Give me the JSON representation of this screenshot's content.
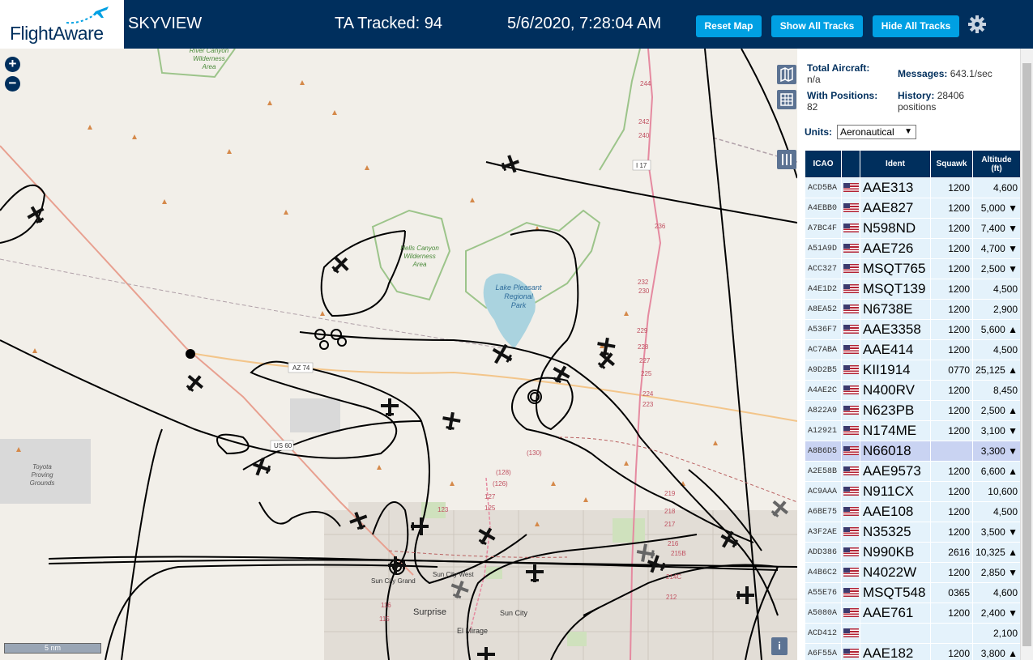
{
  "header": {
    "logo_text": "FlightAware",
    "app_title": "SKYVIEW",
    "tracked": "TA Tracked: 94",
    "datetime": "5/6/2020, 7:28:04 AM",
    "reset_map": "Reset Map",
    "show_all_tracks": "Show All Tracks",
    "hide_all_tracks": "Hide All Tracks"
  },
  "map": {
    "zoom_in": "+",
    "zoom_out": "−",
    "scale": "5 nm",
    "info": "i",
    "labels": {
      "river_canyon": [
        "River Canyon",
        "Wilderness",
        "Area"
      ],
      "hells_canyon": [
        "Hells Canyon",
        "Wilderness",
        "Area"
      ],
      "lake_pleasant": [
        "Lake Pleasant",
        "Regional",
        "Park"
      ],
      "toyota": [
        "Toyota",
        "Proving",
        "Grounds"
      ],
      "az74": "AZ 74",
      "us60": "US 60",
      "i17": "I 17",
      "surprise": "Surprise",
      "sun_city": "Sun City",
      "sun_city_west": "Sun City West",
      "sun_city_grand": "Sun City Grand",
      "el_mirage": "El Mirage"
    }
  },
  "stats": {
    "total_label": "Total Aircraft:",
    "total_value": "n/a",
    "positions_label": "With Positions:",
    "positions_value": "82",
    "messages_label": "Messages:",
    "messages_value": "643.1/sec",
    "history_label": "History:",
    "history_value_1": "28406",
    "history_value_2": "positions",
    "units_label": "Units:",
    "units_value": "Aeronautical"
  },
  "table": {
    "headers": {
      "icao": "ICAO",
      "ident": "Ident",
      "squawk": "Squawk",
      "alt_1": "Altitude",
      "alt_2": "(ft)"
    },
    "rows": [
      {
        "icao": "ACD5BA",
        "ident": "AAE313",
        "squawk": "1200",
        "alt": "4,600 "
      },
      {
        "icao": "A4EBB0",
        "ident": "AAE827",
        "squawk": "1200",
        "alt": "5,000 ▼"
      },
      {
        "icao": "A7BC4F",
        "ident": "N598ND",
        "squawk": "1200",
        "alt": "7,400 ▼"
      },
      {
        "icao": "A51A9D",
        "ident": "AAE726",
        "squawk": "1200",
        "alt": "4,700 ▼"
      },
      {
        "icao": "ACC327",
        "ident": "MSQT765",
        "squawk": "1200",
        "alt": "2,500 ▼"
      },
      {
        "icao": "A4E1D2",
        "ident": "MSQT139",
        "squawk": "1200",
        "alt": "4,500 "
      },
      {
        "icao": "A8EA52",
        "ident": "N6738E",
        "squawk": "1200",
        "alt": "2,900 "
      },
      {
        "icao": "A536F7",
        "ident": "AAE3358",
        "squawk": "1200",
        "alt": "5,600 ▲"
      },
      {
        "icao": "AC7ABA",
        "ident": "AAE414",
        "squawk": "1200",
        "alt": "4,500 "
      },
      {
        "icao": "A9D2B5",
        "ident": "KII1914",
        "squawk": "0770",
        "alt": "25,125 ▲"
      },
      {
        "icao": "A4AE2C",
        "ident": "N400RV",
        "squawk": "1200",
        "alt": "8,450 "
      },
      {
        "icao": "A822A9",
        "ident": "N623PB",
        "squawk": "1200",
        "alt": "2,500 ▲"
      },
      {
        "icao": "A12921",
        "ident": "N174ME",
        "squawk": "1200",
        "alt": "3,100 ▼"
      },
      {
        "icao": "A8B6D5",
        "ident": "N66018",
        "squawk": "",
        "alt": "3,300 ▼",
        "selected": true
      },
      {
        "icao": "A2E58B",
        "ident": "AAE9573",
        "squawk": "1200",
        "alt": "6,600 ▲"
      },
      {
        "icao": "AC9AAA",
        "ident": "N911CX",
        "squawk": "1200",
        "alt": "10,600 "
      },
      {
        "icao": "A6BE75",
        "ident": "AAE108",
        "squawk": "1200",
        "alt": "4,500 "
      },
      {
        "icao": "A3F2AE",
        "ident": "N35325",
        "squawk": "1200",
        "alt": "3,500 ▼"
      },
      {
        "icao": "ADD386",
        "ident": "N990KB",
        "squawk": "2616",
        "alt": "10,325 ▲"
      },
      {
        "icao": "A4B6C2",
        "ident": "N4022W",
        "squawk": "1200",
        "alt": "2,850 ▼"
      },
      {
        "icao": "A55E76",
        "ident": "MSQT548",
        "squawk": "0365",
        "alt": "4,600 "
      },
      {
        "icao": "A5080A",
        "ident": "AAE761",
        "squawk": "1200",
        "alt": "2,400 ▼"
      },
      {
        "icao": "ACD412",
        "ident": "",
        "squawk": "",
        "alt": "2,100 "
      },
      {
        "icao": "A6F55A",
        "ident": "AAE182",
        "squawk": "1200",
        "alt": "3,800 ▲"
      }
    ]
  },
  "colors": {
    "header_bg": "#002f5d",
    "button_bg": "#00a0e3",
    "row_bg": "#e4f2fb",
    "selected_row_bg": "#c9d3f2"
  }
}
